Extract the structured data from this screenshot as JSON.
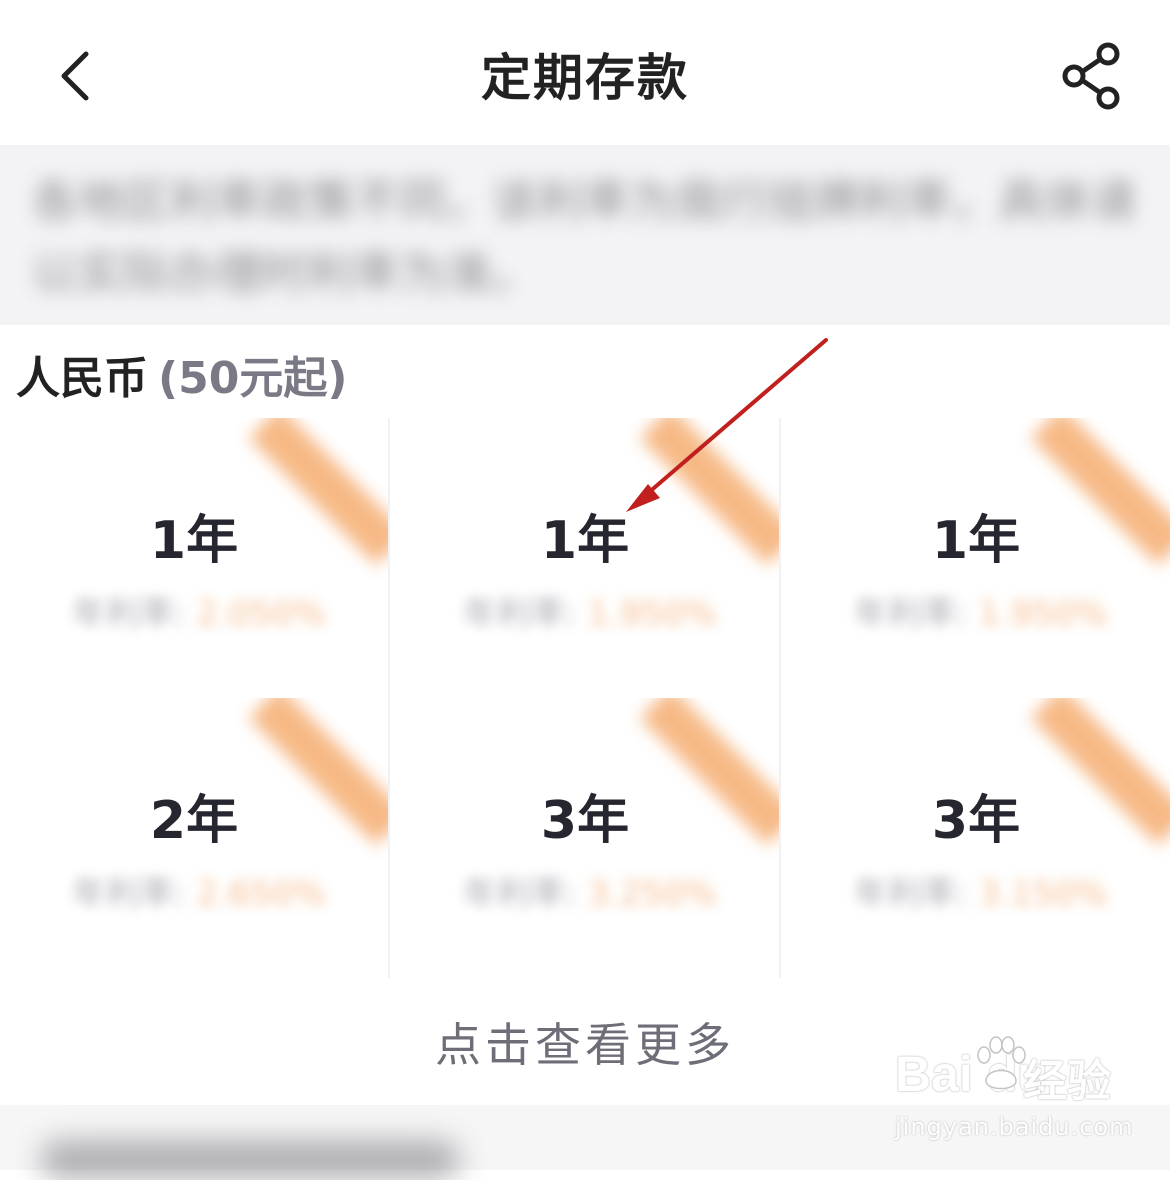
{
  "header": {
    "title": "定期存款",
    "back_icon": "chevron-left-icon",
    "share_icon": "share-icon"
  },
  "notice": {
    "text": "各地区利率政策不同，该利率为我行挂牌利率，具体请以实际办理时利率为准。"
  },
  "section": {
    "title": "人民币",
    "subtitle": "(50元起)"
  },
  "products": [
    {
      "term": "1年",
      "rate_label": "年利率:",
      "rate_value": "2.050%"
    },
    {
      "term": "1年",
      "rate_label": "年利率:",
      "rate_value": "1.950%"
    },
    {
      "term": "1年",
      "rate_label": "年利率:",
      "rate_value": "1.950%"
    },
    {
      "term": "2年",
      "rate_label": "年利率:",
      "rate_value": "2.650%"
    },
    {
      "term": "3年",
      "rate_label": "年利率:",
      "rate_value": "3.250%"
    },
    {
      "term": "3年",
      "rate_label": "年利率:",
      "rate_value": "3.150%"
    }
  ],
  "more_button": {
    "label": "点击查看更多"
  },
  "colors": {
    "accent_orange": "#f6b27a",
    "text_dark": "#222222",
    "annotation_arrow": "#c0201e"
  },
  "watermark": {
    "brand": "Bai du",
    "cn": "经验",
    "url": "jingyan.baidu.com"
  }
}
